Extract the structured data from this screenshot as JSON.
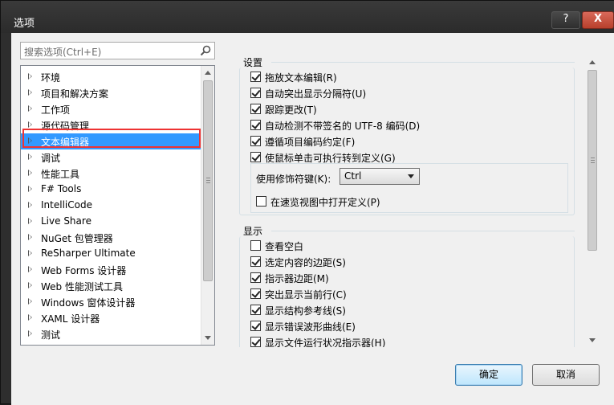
{
  "window": {
    "title": "选项",
    "help_label": "?",
    "close_label": "X"
  },
  "search": {
    "placeholder": "搜索选项(Ctrl+E)"
  },
  "tree": {
    "items": [
      {
        "label": "环境"
      },
      {
        "label": "项目和解决方案"
      },
      {
        "label": "工作项"
      },
      {
        "label": "源代码管理"
      },
      {
        "label": "文本编辑器",
        "selected": true
      },
      {
        "label": "调试"
      },
      {
        "label": "性能工具"
      },
      {
        "label": "F# Tools"
      },
      {
        "label": "IntelliCode"
      },
      {
        "label": "Live Share"
      },
      {
        "label": "NuGet 包管理器"
      },
      {
        "label": "ReSharper Ultimate"
      },
      {
        "label": "Web Forms 设计器"
      },
      {
        "label": "Web 性能测试工具"
      },
      {
        "label": "Windows 窗体设计器"
      },
      {
        "label": "XAML 设计器"
      },
      {
        "label": "测试"
      }
    ]
  },
  "settings": {
    "title": "设置",
    "options": [
      {
        "label": "拖放文本编辑(R)",
        "checked": true
      },
      {
        "label": "自动突出显示分隔符(U)",
        "checked": true
      },
      {
        "label": "跟踪更改(T)",
        "checked": true
      },
      {
        "label": "自动检测不带签名的 UTF-8 编码(D)",
        "checked": true
      },
      {
        "label": "遵循项目编码约定(F)",
        "checked": true
      },
      {
        "label": "使鼠标单击可执行转到定义(G)",
        "checked": true
      }
    ],
    "modifier_label": "使用修饰符键(K):",
    "modifier_value": "Ctrl",
    "peek_label": "在速览视图中打开定义(P)",
    "peek_checked": false
  },
  "display": {
    "title": "显示",
    "options": [
      {
        "label": "查看空白",
        "checked": false
      },
      {
        "label": "选定内容的边距(S)",
        "checked": true
      },
      {
        "label": "指示器边距(M)",
        "checked": true
      },
      {
        "label": "突出显示当前行(C)",
        "checked": true
      },
      {
        "label": "显示结构参考线(S)",
        "checked": true
      },
      {
        "label": "显示错误波形曲线(E)",
        "checked": true
      },
      {
        "label": "显示文件运行状况指示器(H)",
        "checked": true
      }
    ]
  },
  "buttons": {
    "ok": "确定",
    "cancel": "取消"
  }
}
